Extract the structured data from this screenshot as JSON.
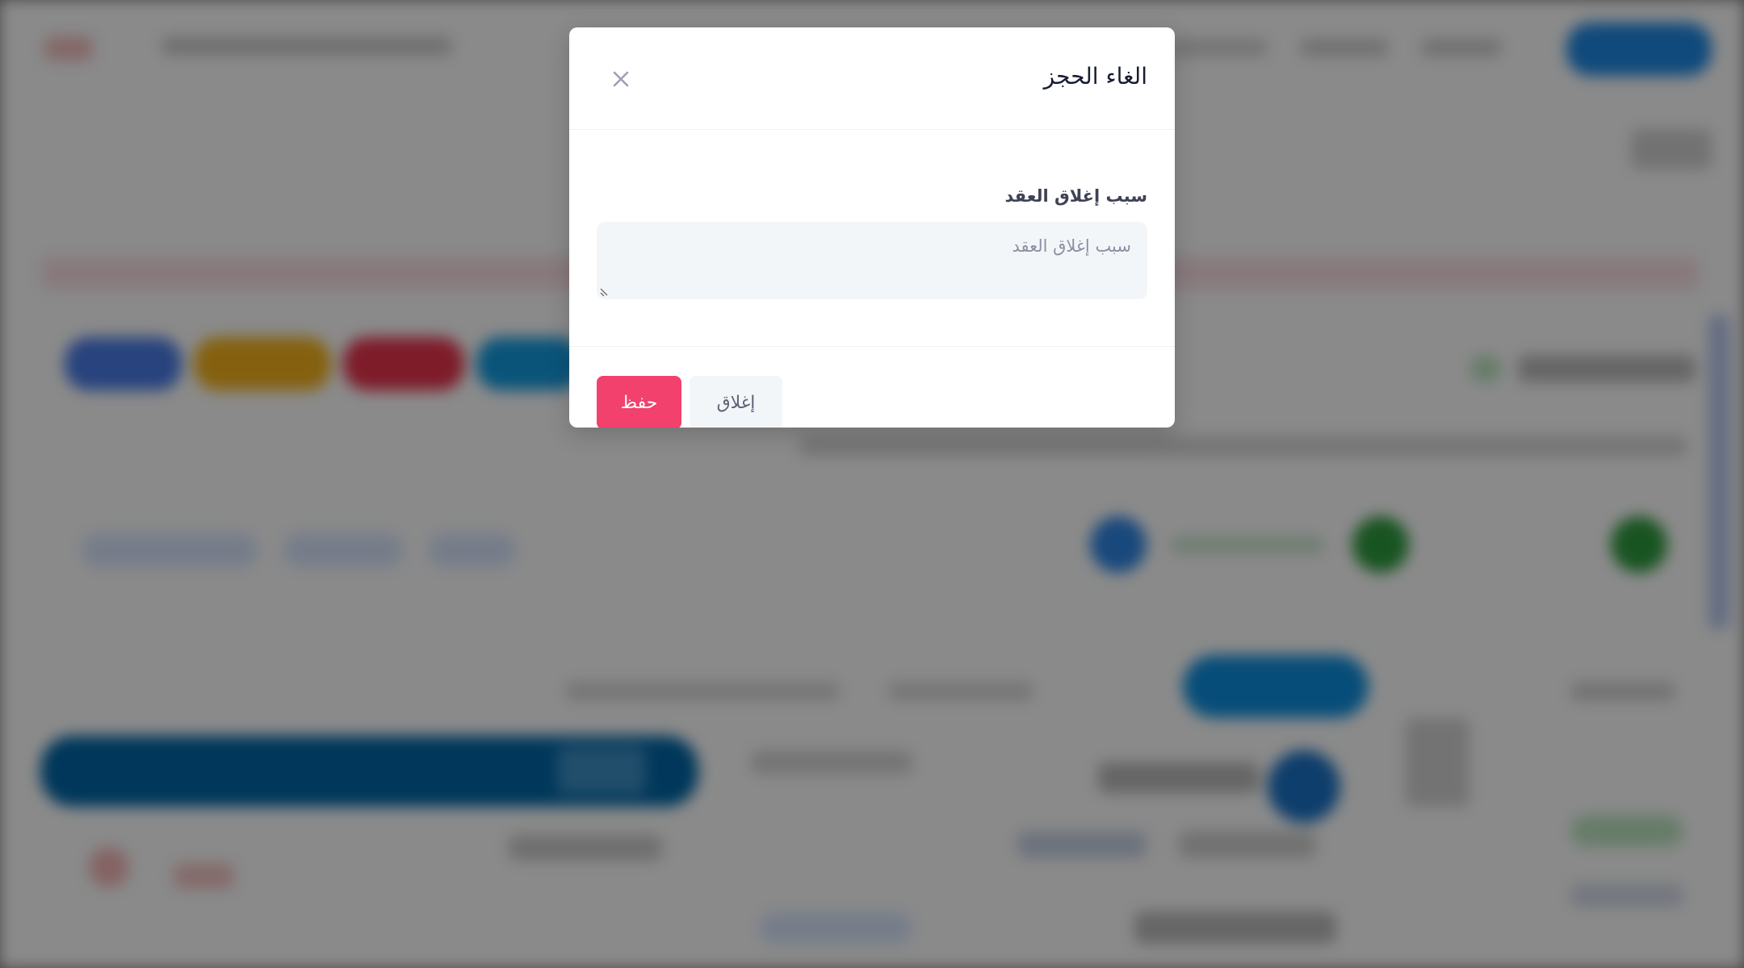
{
  "modal": {
    "title": "الغاء الحجز",
    "close_icon": "close-icon",
    "field_label": "سبب إغلاق العقد",
    "textarea_placeholder": "سبب إغلاق العقد",
    "textarea_value": "",
    "save_label": "حفظ",
    "close_label": "إغلاق"
  },
  "colors": {
    "save_button": "#f1416c",
    "close_button_bg": "#f3f6f9",
    "overlay": "#000000",
    "primary_blue": "#009ef7"
  }
}
